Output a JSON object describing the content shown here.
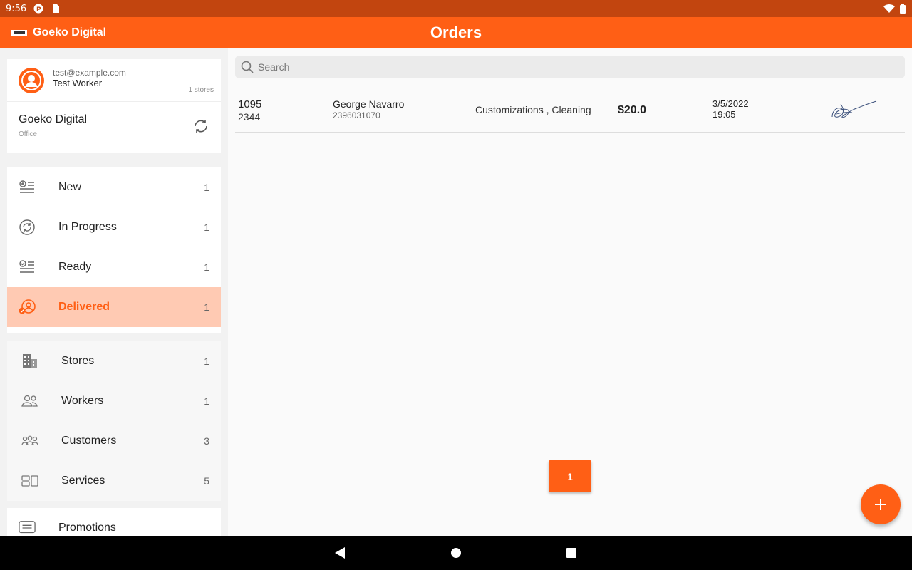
{
  "status_bar": {
    "time": "9:56"
  },
  "app_bar": {
    "brand": "Goeko Digital",
    "title": "Orders"
  },
  "account": {
    "email": "test@example.com",
    "name": "Test Worker",
    "stores_count": "1 stores",
    "org_name": "Goeko Digital",
    "org_type": "Office"
  },
  "nav": {
    "items": [
      {
        "label": "New",
        "count": "1",
        "icon": "new-list-icon"
      },
      {
        "label": "In Progress",
        "count": "1",
        "icon": "progress-icon"
      },
      {
        "label": "Ready",
        "count": "1",
        "icon": "ready-list-icon"
      },
      {
        "label": "Delivered",
        "count": "1",
        "icon": "delivered-icon",
        "active": true
      }
    ]
  },
  "management": {
    "items": [
      {
        "label": "Stores",
        "count": "1",
        "icon": "building-icon"
      },
      {
        "label": "Workers",
        "count": "1",
        "icon": "workers-icon"
      },
      {
        "label": "Customers",
        "count": "3",
        "icon": "customers-icon"
      },
      {
        "label": "Services",
        "count": "5",
        "icon": "services-icon"
      }
    ]
  },
  "promotions": {
    "label": "Promotions"
  },
  "search": {
    "placeholder": "Search"
  },
  "orders": [
    {
      "order_no": "1095",
      "ticket_no": "2344",
      "customer_name": "George Navarro",
      "customer_phone": "2396031070",
      "services": "Customizations , Cleaning",
      "price": "$20.0",
      "date": "3/5/2022",
      "time": "19:05"
    }
  ],
  "pagination": {
    "current_page": "1"
  },
  "colors": {
    "accent": "#ff5f15",
    "status_bar": "#c2450f",
    "active_bg": "#ffcab3"
  }
}
